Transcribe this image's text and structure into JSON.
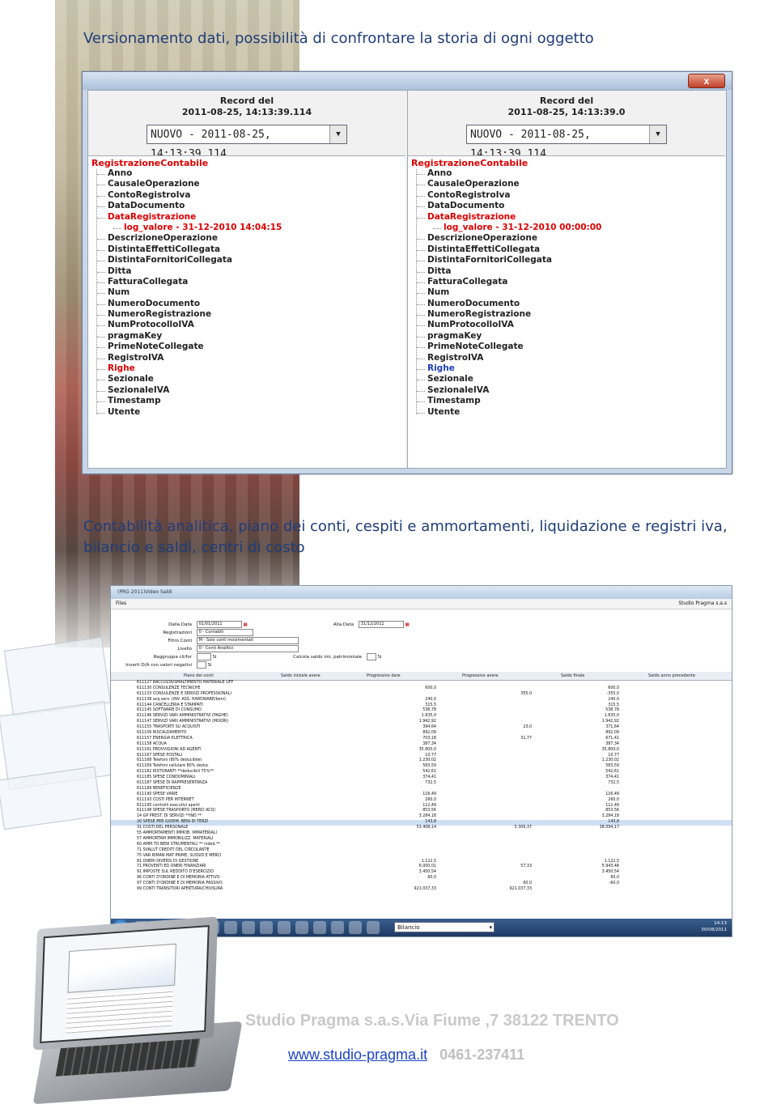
{
  "headings": {
    "versioning": "Versionamento dati, possibilità di confrontare la storia di ogni oggetto",
    "accounting": "Contabilità analitica, piano dei conti, cespiti e ammortamenti, liquidazione e registri iva, bilancio e saldi, centri di costo"
  },
  "compare_window": {
    "close_label": "x",
    "left": {
      "record_label": "Record del",
      "record_date": "2011-08-25, 14:13:39.114",
      "combo_value": "NUOVO - 2011-08-25, 14:13:39.114",
      "root": "RegistrazioneContabile",
      "items": [
        "Anno",
        "CausaleOperazione",
        "ContoRegistroIva",
        "DataDocumento",
        "DataRegistrazione",
        "log_valore - 31-12-2010 14:04:15",
        "DescrizioneOperazione",
        "DistintaEffettiCollegata",
        "DistintaFornitoriCollegata",
        "Ditta",
        "FatturaCollegata",
        "Num",
        "NumeroDocumento",
        "NumeroRegistrazione",
        "NumProtocolloIVA",
        "pragmaKey",
        "PrimeNoteCollegate",
        "RegistroIVA",
        "Righe",
        "Sezionale",
        "SezionaleIVA",
        "Timestamp",
        "Utente"
      ]
    },
    "right": {
      "record_label": "Record del",
      "record_date": "2011-08-25, 14:13:39.0",
      "combo_value": "NUOVO - 2011-08-25, 14:13:39.114",
      "root": "RegistrazioneContabile",
      "items": [
        "Anno",
        "CausaleOperazione",
        "ContoRegistroIva",
        "DataDocumento",
        "DataRegistrazione",
        "log_valore - 31-12-2010 00:00:00",
        "DescrizioneOperazione",
        "DistintaEffettiCollegata",
        "DistintaFornitoriCollegata",
        "Ditta",
        "FatturaCollegata",
        "Num",
        "NumeroDocumento",
        "NumeroRegistrazione",
        "NumProtocolloIVA",
        "pragmaKey",
        "PrimeNoteCollegate",
        "RegistroIVA",
        "Righe",
        "Sezionale",
        "SezionaleIVA",
        "Timestamp",
        "Utente"
      ]
    }
  },
  "balance_window": {
    "title": "(PRG 2011)Video Saldi",
    "menu": "Files",
    "brand": "Studio Pragma s.a.s",
    "filters": {
      "dalla_data_label": "Dalla Data",
      "dalla_data": "01/01/2011",
      "alla_data_label": "Alla Data",
      "alla_data": "31/12/2011",
      "registrazioni_label": "Registrazioni",
      "registrazioni": "0 - Contabili",
      "filtro_conti_label": "Filtro Conti",
      "filtro_conti": "M - Solo conti movimentati",
      "livello_label": "Livello",
      "livello": "0 - Conti Analitici",
      "raggruppa_label": "Raggruppa cli/for",
      "raggruppa": "Si",
      "calcola_label": "Calcola saldo imi. patrimoniale",
      "calcola": "Si",
      "inverti_label": "Inverti D/A con valori negativi",
      "inverti": "Si"
    },
    "columns": [
      "Piano dei conti",
      "Saldo iniziale avere",
      "Progressivo dare",
      "Progressivo avere",
      "Saldo finale",
      "Saldo anno precedente"
    ],
    "rows": [
      {
        "desc": "611127 RACCOLTA/SMALTIMENTO MATERIALE UFF",
        "v1": "",
        "v2": "",
        "v3": ""
      },
      {
        "desc": "611130 CONSULENZE TECNICHE",
        "v1": "600,0",
        "v2": "",
        "v3": "600,0"
      },
      {
        "desc": "611133 CONSULENZE E SERVIZI PROFESSIONALI",
        "v1": "",
        "v2": "355,0",
        "v3": "-355,0"
      },
      {
        "desc": "611138 acq.serv. (INV. ASS. HARDWARE/beni)",
        "v1": "240,0",
        "v2": "",
        "v3": "240,0"
      },
      {
        "desc": "611144 CANCELLERIA E STAMPATI",
        "v1": "315,5",
        "v2": "",
        "v3": "315,5"
      },
      {
        "desc": "611145 SOFTWARE DI CONSUMO",
        "v1": "538,78",
        "v2": "",
        "v3": "538,78"
      },
      {
        "desc": "611146 SERVIZI VARI AMMINISTRATIVI (PAGHE)",
        "v1": "1.835,0",
        "v2": "",
        "v3": "1.835,0"
      },
      {
        "desc": "611147 SERVIZI VARI AMMINISTRATIVI (MOORI)",
        "v1": "1.942,92",
        "v2": "",
        "v3": "1.942,92"
      },
      {
        "desc": "611155 TRASPORTI SU ACQUISTI",
        "v1": "394,64",
        "v2": "23,0",
        "v3": "371,64"
      },
      {
        "desc": "611156 RISCALDAMENTO",
        "v1": "892,09",
        "v2": "",
        "v3": "892,09"
      },
      {
        "desc": "611157 ENERGIA ELETTRICA",
        "v1": "703,18",
        "v2": "31,77",
        "v3": "671,41"
      },
      {
        "desc": "611158 ACQUA",
        "v1": "387,34",
        "v2": "",
        "v3": "387,34"
      },
      {
        "desc": "611161 PROVVIGIONI AD AGENTI",
        "v1": "35.800,0",
        "v2": "",
        "v3": "35.800,0"
      },
      {
        "desc": "611167 SPESE POSTALI",
        "v1": "10,77",
        "v2": "",
        "v3": "10,77"
      },
      {
        "desc": "611168 Telefoni (80% deducibile)",
        "v1": "1.230,02",
        "v2": "",
        "v3": "1.230,02"
      },
      {
        "desc": "611169 Telefoni cellulare 80% deduc",
        "v1": "583,59",
        "v2": "",
        "v3": "583,59"
      },
      {
        "desc": "611182 RISTORANTI **deducibili 75%**",
        "v1": "542,61",
        "v2": "",
        "v3": "542,61"
      },
      {
        "desc": "611185 SPESE CONDOMINIALI",
        "v1": "374,41",
        "v2": "",
        "v3": "374,41"
      },
      {
        "desc": "611187 SPESE DI RAPPRESENTANZA",
        "v1": "732,5",
        "v2": "",
        "v3": "732,5"
      },
      {
        "desc": "611189 BENEFICIENZE",
        "v1": "",
        "v2": "",
        "v3": ""
      },
      {
        "desc": "611190 SPESE VARIE",
        "v1": "116,49",
        "v2": "",
        "v3": "116,49"
      },
      {
        "desc": "611193 COSTI PER INTERNET",
        "v1": "260,0",
        "v2": "",
        "v3": "260,0"
      },
      {
        "desc": "611195 controlli esecutivi aperti",
        "v1": "112,49",
        "v2": "",
        "v3": "112,49"
      },
      {
        "desc": "611198 SPESE TRASPORTO (MERCI ACQ)",
        "v1": "853,56",
        "v2": "",
        "v3": "853,56"
      },
      {
        "desc": "14 GP PREST. DI SERVIZI **IND.**",
        "v1": "3.284,18",
        "v2": "",
        "v3": "3.284,18"
      },
      {
        "desc": "20 SPESE PER GODIM. BENI DI TERZI",
        "v1": "143,8",
        "v2": "",
        "v3": "143,8",
        "sel": true
      },
      {
        "desc": "31 COSTI DEL PERSONALE",
        "v1": "53.408,14",
        "v2": "5.309,37",
        "v3": "38.094,17"
      },
      {
        "desc": "55 AMMORTAMENTI IMMOB. IMMATERIALI",
        "v1": "",
        "v2": "",
        "v3": ""
      },
      {
        "desc": "57 AMMORTAM IMMOBILIZZ. MATERIALI",
        "v1": "",
        "v2": "",
        "v3": ""
      },
      {
        "desc": "60 AMM.TO BENI STRUMENTALI ** inded.**",
        "v1": "",
        "v2": "",
        "v3": ""
      },
      {
        "desc": "71 SVALUT CREDITI DEL CIRCOLANTE",
        "v1": "",
        "v2": "",
        "v3": ""
      },
      {
        "desc": "75 VAR RIMAN MAT PRIME, SUSSID E MERCI",
        "v1": "",
        "v2": "",
        "v3": ""
      },
      {
        "desc": "81 ONERI DIVERSI DI GESTIONE",
        "v1": "1.122,5",
        "v2": "",
        "v3": "1.122,5"
      },
      {
        "desc": "71 PROVENTI ED ONERI FINANZIARI",
        "v1": "6.000,01",
        "v2": "57,33",
        "v3": "5.943,48"
      },
      {
        "desc": "91 IMPOSTE SUL REDDITO D'ESERCIZIO",
        "v1": "3.450,54",
        "v2": "",
        "v3": "3.450,54"
      },
      {
        "desc": "96 CONTI D'ORDINE E DI MEMORIA ATTIVO",
        "v1": "60,0",
        "v2": "",
        "v3": "60,0"
      },
      {
        "desc": "97 CONTI D'ORDINE E DI MEMORIA PASSIVO",
        "v1": "",
        "v2": "60,0",
        "v3": "-60,0"
      },
      {
        "desc": "99 CONTI TRANSITORI APERTURA/CHIUSURA",
        "v1": "921.037,33",
        "v2": "921.037,33",
        "v3": ""
      }
    ],
    "bottom_select": "Bilancio",
    "clock_time": "14:13",
    "clock_date": "30/08/2011"
  },
  "footer": {
    "company": "Studio Pragma s.a.s.Via Fiume ,7 38122 TRENTO",
    "website": "www.studio-pragma.it",
    "phone": "0461-237411"
  }
}
